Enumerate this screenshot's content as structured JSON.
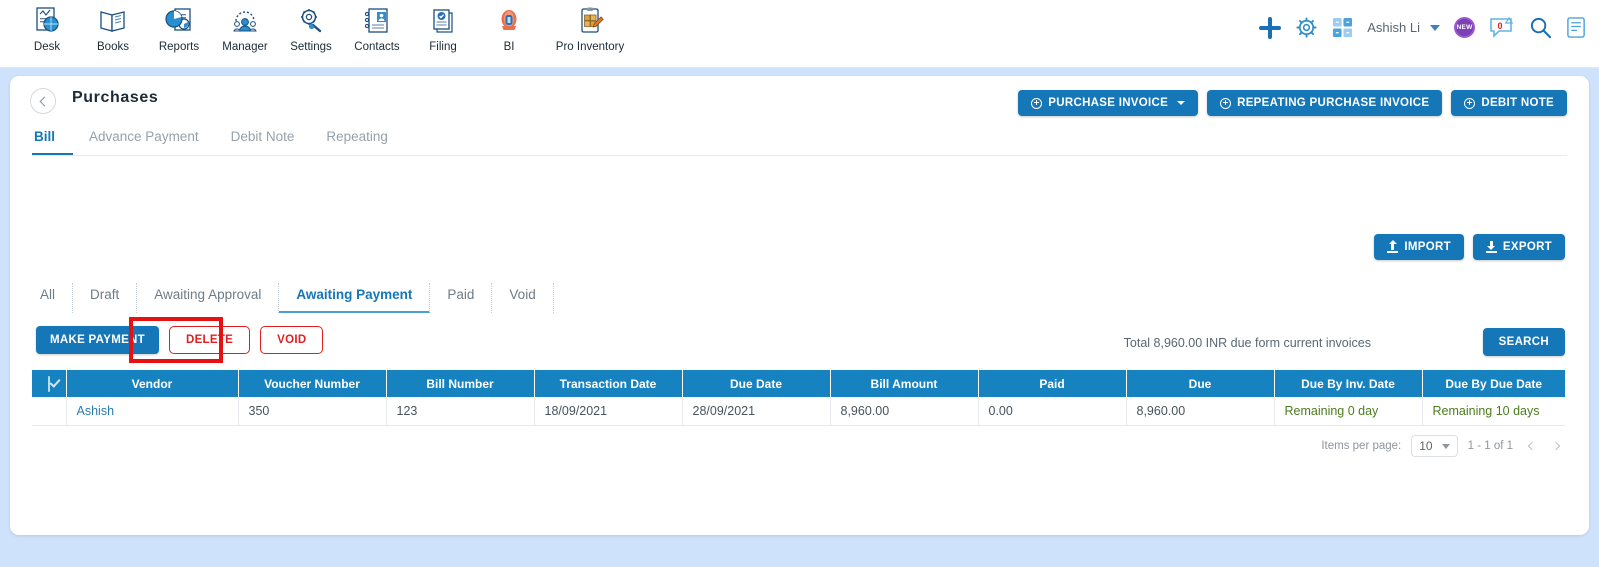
{
  "appnav": {
    "items": [
      {
        "label": "Desk",
        "icon": "dashboard-icon"
      },
      {
        "label": "Books",
        "icon": "book-icon"
      },
      {
        "label": "Reports",
        "icon": "report-chart-icon"
      },
      {
        "label": "Manager",
        "icon": "manager-people-icon"
      },
      {
        "label": "Settings",
        "icon": "gear-wrench-icon"
      },
      {
        "label": "Contacts",
        "icon": "contacts-book-icon"
      },
      {
        "label": "Filing",
        "icon": "filing-doc-icon"
      },
      {
        "label": "BI",
        "icon": "bi-icon"
      },
      {
        "label": "Pro Inventory",
        "icon": "inventory-clipboard-icon"
      }
    ]
  },
  "topbar": {
    "add_icon": "plus-icon",
    "settings_icon": "gear-icon",
    "apps_icon": "apps-grid-icon",
    "username": "Ashish Li",
    "user_caret": "chevron-down-icon",
    "new_badge": "NEW",
    "chat_icon": "chat-bubble-icon",
    "chat_count": "0",
    "search_icon": "search-icon",
    "notes_icon": "notes-icon"
  },
  "header": {
    "back_icon": "chevron-left-icon",
    "title": "Purchases",
    "actions": [
      {
        "label": "PURCHASE INVOICE",
        "icon": "plus-circle-icon",
        "has_caret": true
      },
      {
        "label": "REPEATING PURCHASE INVOICE",
        "icon": "plus-circle-icon",
        "has_caret": false
      },
      {
        "label": "DEBIT NOTE",
        "icon": "plus-circle-icon",
        "has_caret": false
      }
    ]
  },
  "tabs": [
    {
      "label": "Bill",
      "active": true
    },
    {
      "label": "Advance Payment",
      "active": false
    },
    {
      "label": "Debit Note",
      "active": false
    },
    {
      "label": "Repeating",
      "active": false
    }
  ],
  "io_buttons": [
    {
      "label": "IMPORT",
      "icon": "upload-icon"
    },
    {
      "label": "EXPORT",
      "icon": "download-icon"
    }
  ],
  "filters": [
    {
      "label": "All",
      "active": false
    },
    {
      "label": "Draft",
      "active": false
    },
    {
      "label": "Awaiting Approval",
      "active": false
    },
    {
      "label": "Awaiting Payment",
      "active": true
    },
    {
      "label": "Paid",
      "active": false
    },
    {
      "label": "Void",
      "active": false
    }
  ],
  "actions": {
    "make_payment": "MAKE PAYMENT",
    "delete": "DELETE",
    "void": "VOID",
    "total_text": "Total 8,960.00 INR due form current invoices",
    "search": "SEARCH"
  },
  "table": {
    "columns": [
      "Vendor",
      "Voucher Number",
      "Bill Number",
      "Transaction Date",
      "Due Date",
      "Bill Amount",
      "Paid",
      "Due",
      "Due By Inv. Date",
      "Due By Due Date"
    ],
    "rows": [
      {
        "selected": true,
        "vendor": "Ashish",
        "voucher_number": "350",
        "bill_number": "123",
        "transaction_date": "18/09/2021",
        "due_date": "28/09/2021",
        "bill_amount": "8,960.00",
        "paid": "0.00",
        "due": "8,960.00",
        "due_by_inv_date": "Remaining 0 day",
        "due_by_due_date": "Remaining 10 days"
      }
    ]
  },
  "paginator": {
    "label": "Items per page:",
    "per_page": "10",
    "range": "1 - 1 of 1",
    "prev_icon": "chevron-left-icon",
    "next_icon": "chevron-right-icon"
  },
  "colors": {
    "accent": "#1577b8",
    "table_header": "#1782c0",
    "danger": "#e02020",
    "annotation": "#e81111",
    "page_bg": "#cfe2fb",
    "green_text": "#4b7d1e"
  }
}
